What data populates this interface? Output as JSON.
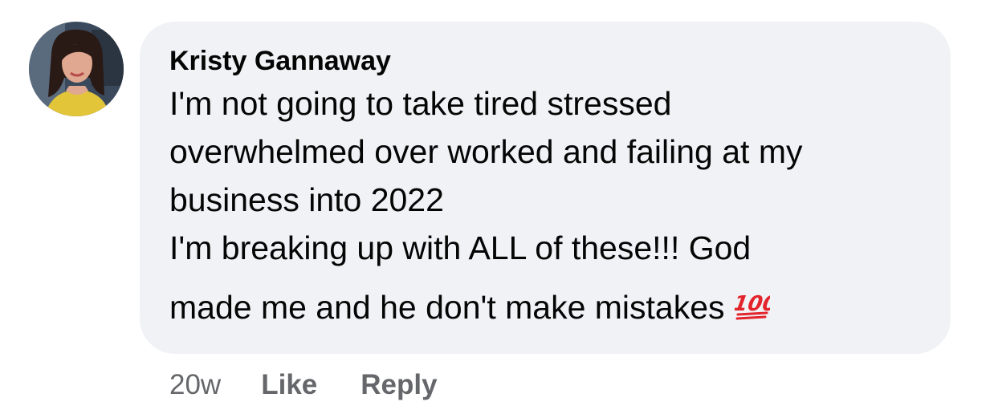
{
  "comment": {
    "author": "Kristy Gannaway",
    "text_lines": [
      "I'm not going to take tired stressed",
      "overwhelmed over worked and failing at my",
      "business into 2022",
      "I'm breaking up with ALL of these!!! God",
      "made me and he don't make mistakes"
    ],
    "emoji": "100-points-icon",
    "timestamp": "20w",
    "like_label": "Like",
    "reply_label": "Reply"
  },
  "colors": {
    "bubble_bg": "#f0f2f5",
    "text": "#050505",
    "meta": "#65676b",
    "emoji_red": "#e3242b"
  }
}
